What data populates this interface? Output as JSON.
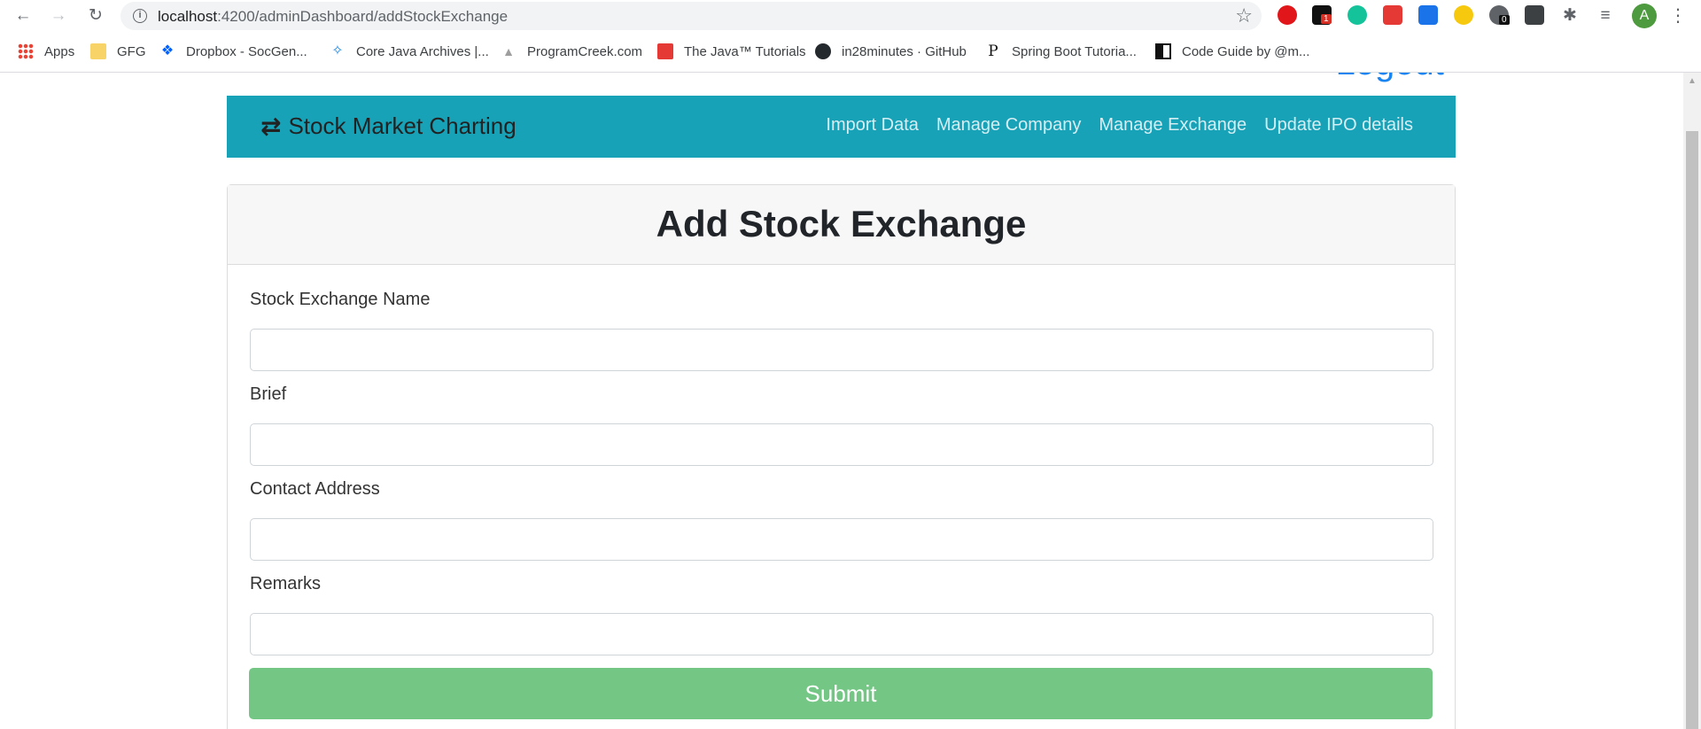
{
  "browser": {
    "url_host": "localhost",
    "url_path": ":4200/adminDashboard/addStockExchange",
    "bookmarks": [
      {
        "label": "Apps"
      },
      {
        "label": "GFG"
      },
      {
        "label": "Dropbox - SocGen..."
      },
      {
        "label": "Core Java Archives |..."
      },
      {
        "label": "ProgramCreek.com"
      },
      {
        "label": "The Java™ Tutorials"
      },
      {
        "label": "in28minutes · GitHub"
      },
      {
        "label": "Spring Boot Tutoria..."
      },
      {
        "label": "Code Guide by @m..."
      }
    ],
    "profile_initial": "A",
    "extension_badge_1": "1",
    "extension_badge_2": "0"
  },
  "header": {
    "logout_label": "Logout"
  },
  "navbar": {
    "brand": "Stock Market Charting",
    "links": [
      {
        "label": "Import Data"
      },
      {
        "label": "Manage Company"
      },
      {
        "label": "Manage Exchange"
      },
      {
        "label": "Update IPO details"
      }
    ]
  },
  "form": {
    "title": "Add Stock Exchange",
    "fields": [
      {
        "label": "Stock Exchange Name",
        "value": ""
      },
      {
        "label": "Brief",
        "value": ""
      },
      {
        "label": "Contact Address",
        "value": ""
      },
      {
        "label": "Remarks",
        "value": ""
      }
    ],
    "submit_label": "Submit"
  },
  "colors": {
    "navbar_bg": "#17a2b8",
    "submit_bg": "#74c685",
    "logout": "#1a84f0"
  }
}
